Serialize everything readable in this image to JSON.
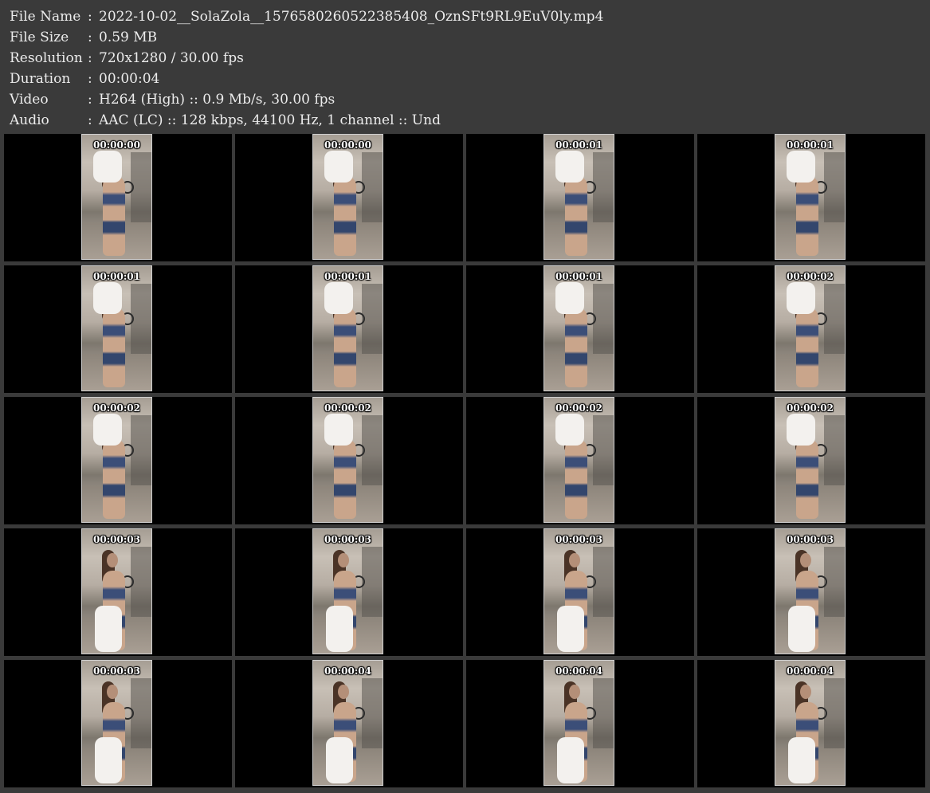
{
  "info": [
    {
      "label": "File Name",
      "value": "2022-10-02__SolaZola__1576580260522385408_OznSFt9RL9EuV0ly.mp4"
    },
    {
      "label": "File Size",
      "value": "0.59 MB"
    },
    {
      "label": "Resolution",
      "value": "720x1280 / 30.00 fps"
    },
    {
      "label": "Duration",
      "value": "00:00:04"
    },
    {
      "label": "Video",
      "value": "H264 (High) :: 0.9 Mb/s, 30.00 fps"
    },
    {
      "label": "Audio",
      "value": "AAC (LC) :: 128 kbps, 44100 Hz, 1 channel :: Und"
    }
  ],
  "separator": ":",
  "thumbnails": [
    {
      "timestamp": "00:00:00",
      "cloth": "up"
    },
    {
      "timestamp": "00:00:00",
      "cloth": "up"
    },
    {
      "timestamp": "00:00:01",
      "cloth": "up"
    },
    {
      "timestamp": "00:00:01",
      "cloth": "up"
    },
    {
      "timestamp": "00:00:01",
      "cloth": "up"
    },
    {
      "timestamp": "00:00:01",
      "cloth": "up"
    },
    {
      "timestamp": "00:00:01",
      "cloth": "up"
    },
    {
      "timestamp": "00:00:02",
      "cloth": "up"
    },
    {
      "timestamp": "00:00:02",
      "cloth": "up"
    },
    {
      "timestamp": "00:00:02",
      "cloth": "up"
    },
    {
      "timestamp": "00:00:02",
      "cloth": "up"
    },
    {
      "timestamp": "00:00:02",
      "cloth": "up"
    },
    {
      "timestamp": "00:00:03",
      "cloth": "down"
    },
    {
      "timestamp": "00:00:03",
      "cloth": "down"
    },
    {
      "timestamp": "00:00:03",
      "cloth": "down"
    },
    {
      "timestamp": "00:00:03",
      "cloth": "down"
    },
    {
      "timestamp": "00:00:03",
      "cloth": "down"
    },
    {
      "timestamp": "00:00:04",
      "cloth": "down"
    },
    {
      "timestamp": "00:00:04",
      "cloth": "down"
    },
    {
      "timestamp": "00:00:04",
      "cloth": "down"
    }
  ]
}
